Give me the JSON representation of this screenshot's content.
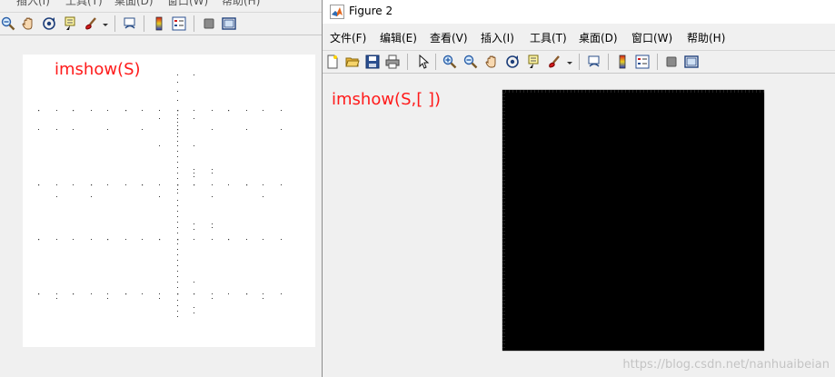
{
  "left_window": {
    "menu": [
      "插入(I)",
      "工具(T)",
      "桌面(D)",
      "窗口(W)",
      "帮助(H)"
    ],
    "image_label": "imshow(S)"
  },
  "right_window": {
    "title": "Figure 2",
    "menu": [
      "文件(F)",
      "编辑(E)",
      "查看(V)",
      "插入(I)",
      "工具(T)",
      "桌面(D)",
      "窗口(W)",
      "帮助(H)"
    ],
    "image_label": "imshow(S,[ ])"
  },
  "watermark": "https://blog.csdn.net/nanhuaibeian"
}
